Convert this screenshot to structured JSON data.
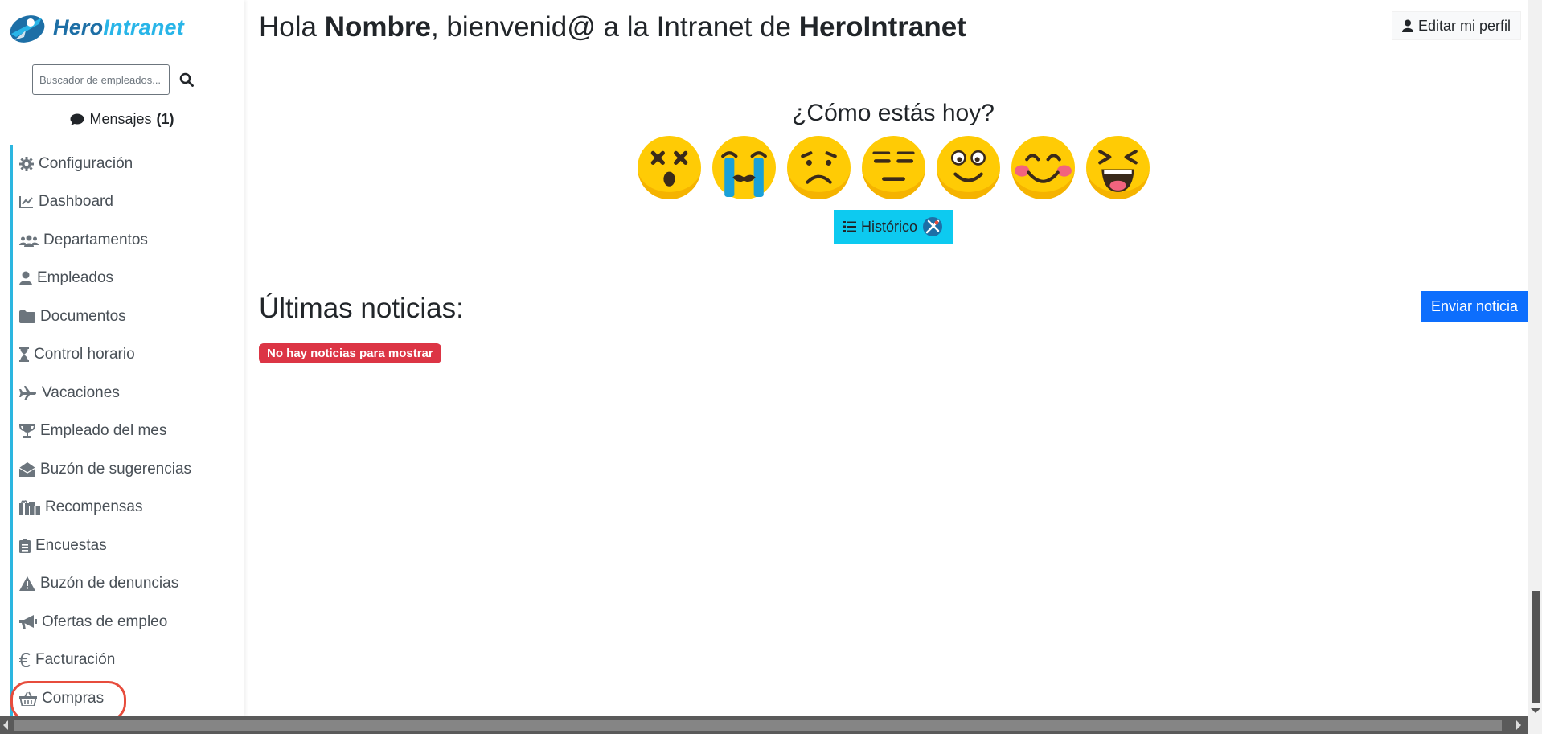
{
  "brand": {
    "part1": "Hero",
    "part2": "Intranet"
  },
  "search": {
    "placeholder": "Buscador de empleados..."
  },
  "messages": {
    "label": "Mensajes",
    "count": "(1)"
  },
  "nav": [
    {
      "label": "Configuración",
      "icon": "gear-icon"
    },
    {
      "label": "Dashboard",
      "icon": "chart-line-icon"
    },
    {
      "label": "Departamentos",
      "icon": "users-icon"
    },
    {
      "label": "Empleados",
      "icon": "user-icon"
    },
    {
      "label": "Documentos",
      "icon": "folder-icon"
    },
    {
      "label": "Control horario",
      "icon": "hourglass-icon"
    },
    {
      "label": "Vacaciones",
      "icon": "plane-icon"
    },
    {
      "label": "Empleado del mes",
      "icon": "trophy-icon"
    },
    {
      "label": "Buzón de sugerencias",
      "icon": "envelope-open-icon"
    },
    {
      "label": "Recompensas",
      "icon": "gifts-icon"
    },
    {
      "label": "Encuestas",
      "icon": "clipboard-list-icon"
    },
    {
      "label": "Buzón de denuncias",
      "icon": "warning-icon"
    },
    {
      "label": "Ofertas de empleo",
      "icon": "bullhorn-icon"
    },
    {
      "label": "Facturación",
      "icon": "euro-icon"
    },
    {
      "label": "Compras",
      "icon": "basket-icon"
    }
  ],
  "header": {
    "greeting_prefix": "Hola ",
    "name": "Nombre",
    "greeting_mid": ", bienvenid@ a la Intranet de ",
    "company": "HeroIntranet",
    "edit_profile": "Editar mi perfil"
  },
  "mood": {
    "question": "¿Cómo estás hoy?",
    "emojis": [
      "dizzy-face-icon",
      "crying-face-icon",
      "sad-face-icon",
      "expressionless-face-icon",
      "smiling-face-icon",
      "blushing-face-icon",
      "laughing-face-icon"
    ],
    "history_label": "Histórico"
  },
  "news": {
    "title": "Últimas noticias:",
    "send_label": "Enviar noticia",
    "empty_label": "No hay noticias para mostrar"
  },
  "colors": {
    "accent": "#2cb6e0",
    "primary": "#0d6efd",
    "info": "#0dcaf0",
    "danger": "#dc3545",
    "highlight": "#e74c3c"
  }
}
